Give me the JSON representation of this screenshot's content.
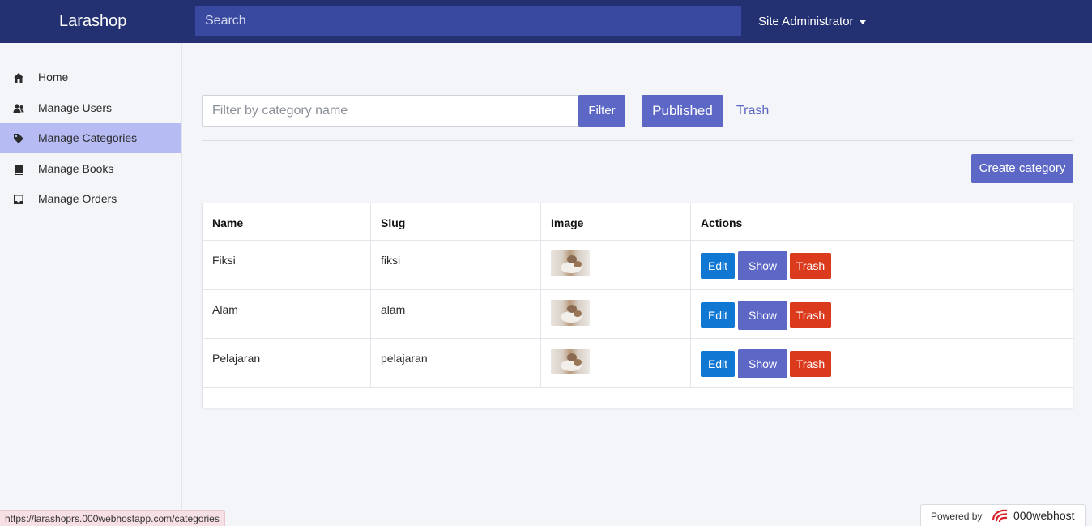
{
  "app": {
    "brand": "Larashop",
    "search_placeholder": "Search",
    "user_menu": "Site Administrator"
  },
  "sidebar": {
    "items": [
      {
        "label": "Home",
        "icon": "home-icon"
      },
      {
        "label": "Manage Users",
        "icon": "users-icon"
      },
      {
        "label": "Manage Categories",
        "icon": "tag-icon",
        "active": true
      },
      {
        "label": "Manage Books",
        "icon": "book-icon"
      },
      {
        "label": "Manage Orders",
        "icon": "inbox-icon"
      }
    ]
  },
  "toolbar": {
    "filter_placeholder": "Filter by category name",
    "filter_label": "Filter",
    "published_label": "Published",
    "trash_label": "Trash",
    "create_label": "Create category"
  },
  "table": {
    "headers": [
      "Name",
      "Slug",
      "Image",
      "Actions"
    ],
    "rows": [
      {
        "name": "Fiksi",
        "slug": "fiksi"
      },
      {
        "name": "Alam",
        "slug": "alam"
      },
      {
        "name": "Pelajaran",
        "slug": "pelajaran"
      }
    ],
    "actions": {
      "edit": "Edit",
      "show": "Show",
      "trash": "Trash"
    }
  },
  "statusbar": {
    "url": "https://larashoprs.000webhostapp.com/categories"
  },
  "footer_badge": {
    "powered_by": "Powered by",
    "brand": "000webhost"
  },
  "colors": {
    "topbar": "#233172",
    "primary": "#5c67c6",
    "edit": "#1078d3",
    "danger": "#dc3a1d",
    "active_nav": "#b6bcf3"
  }
}
